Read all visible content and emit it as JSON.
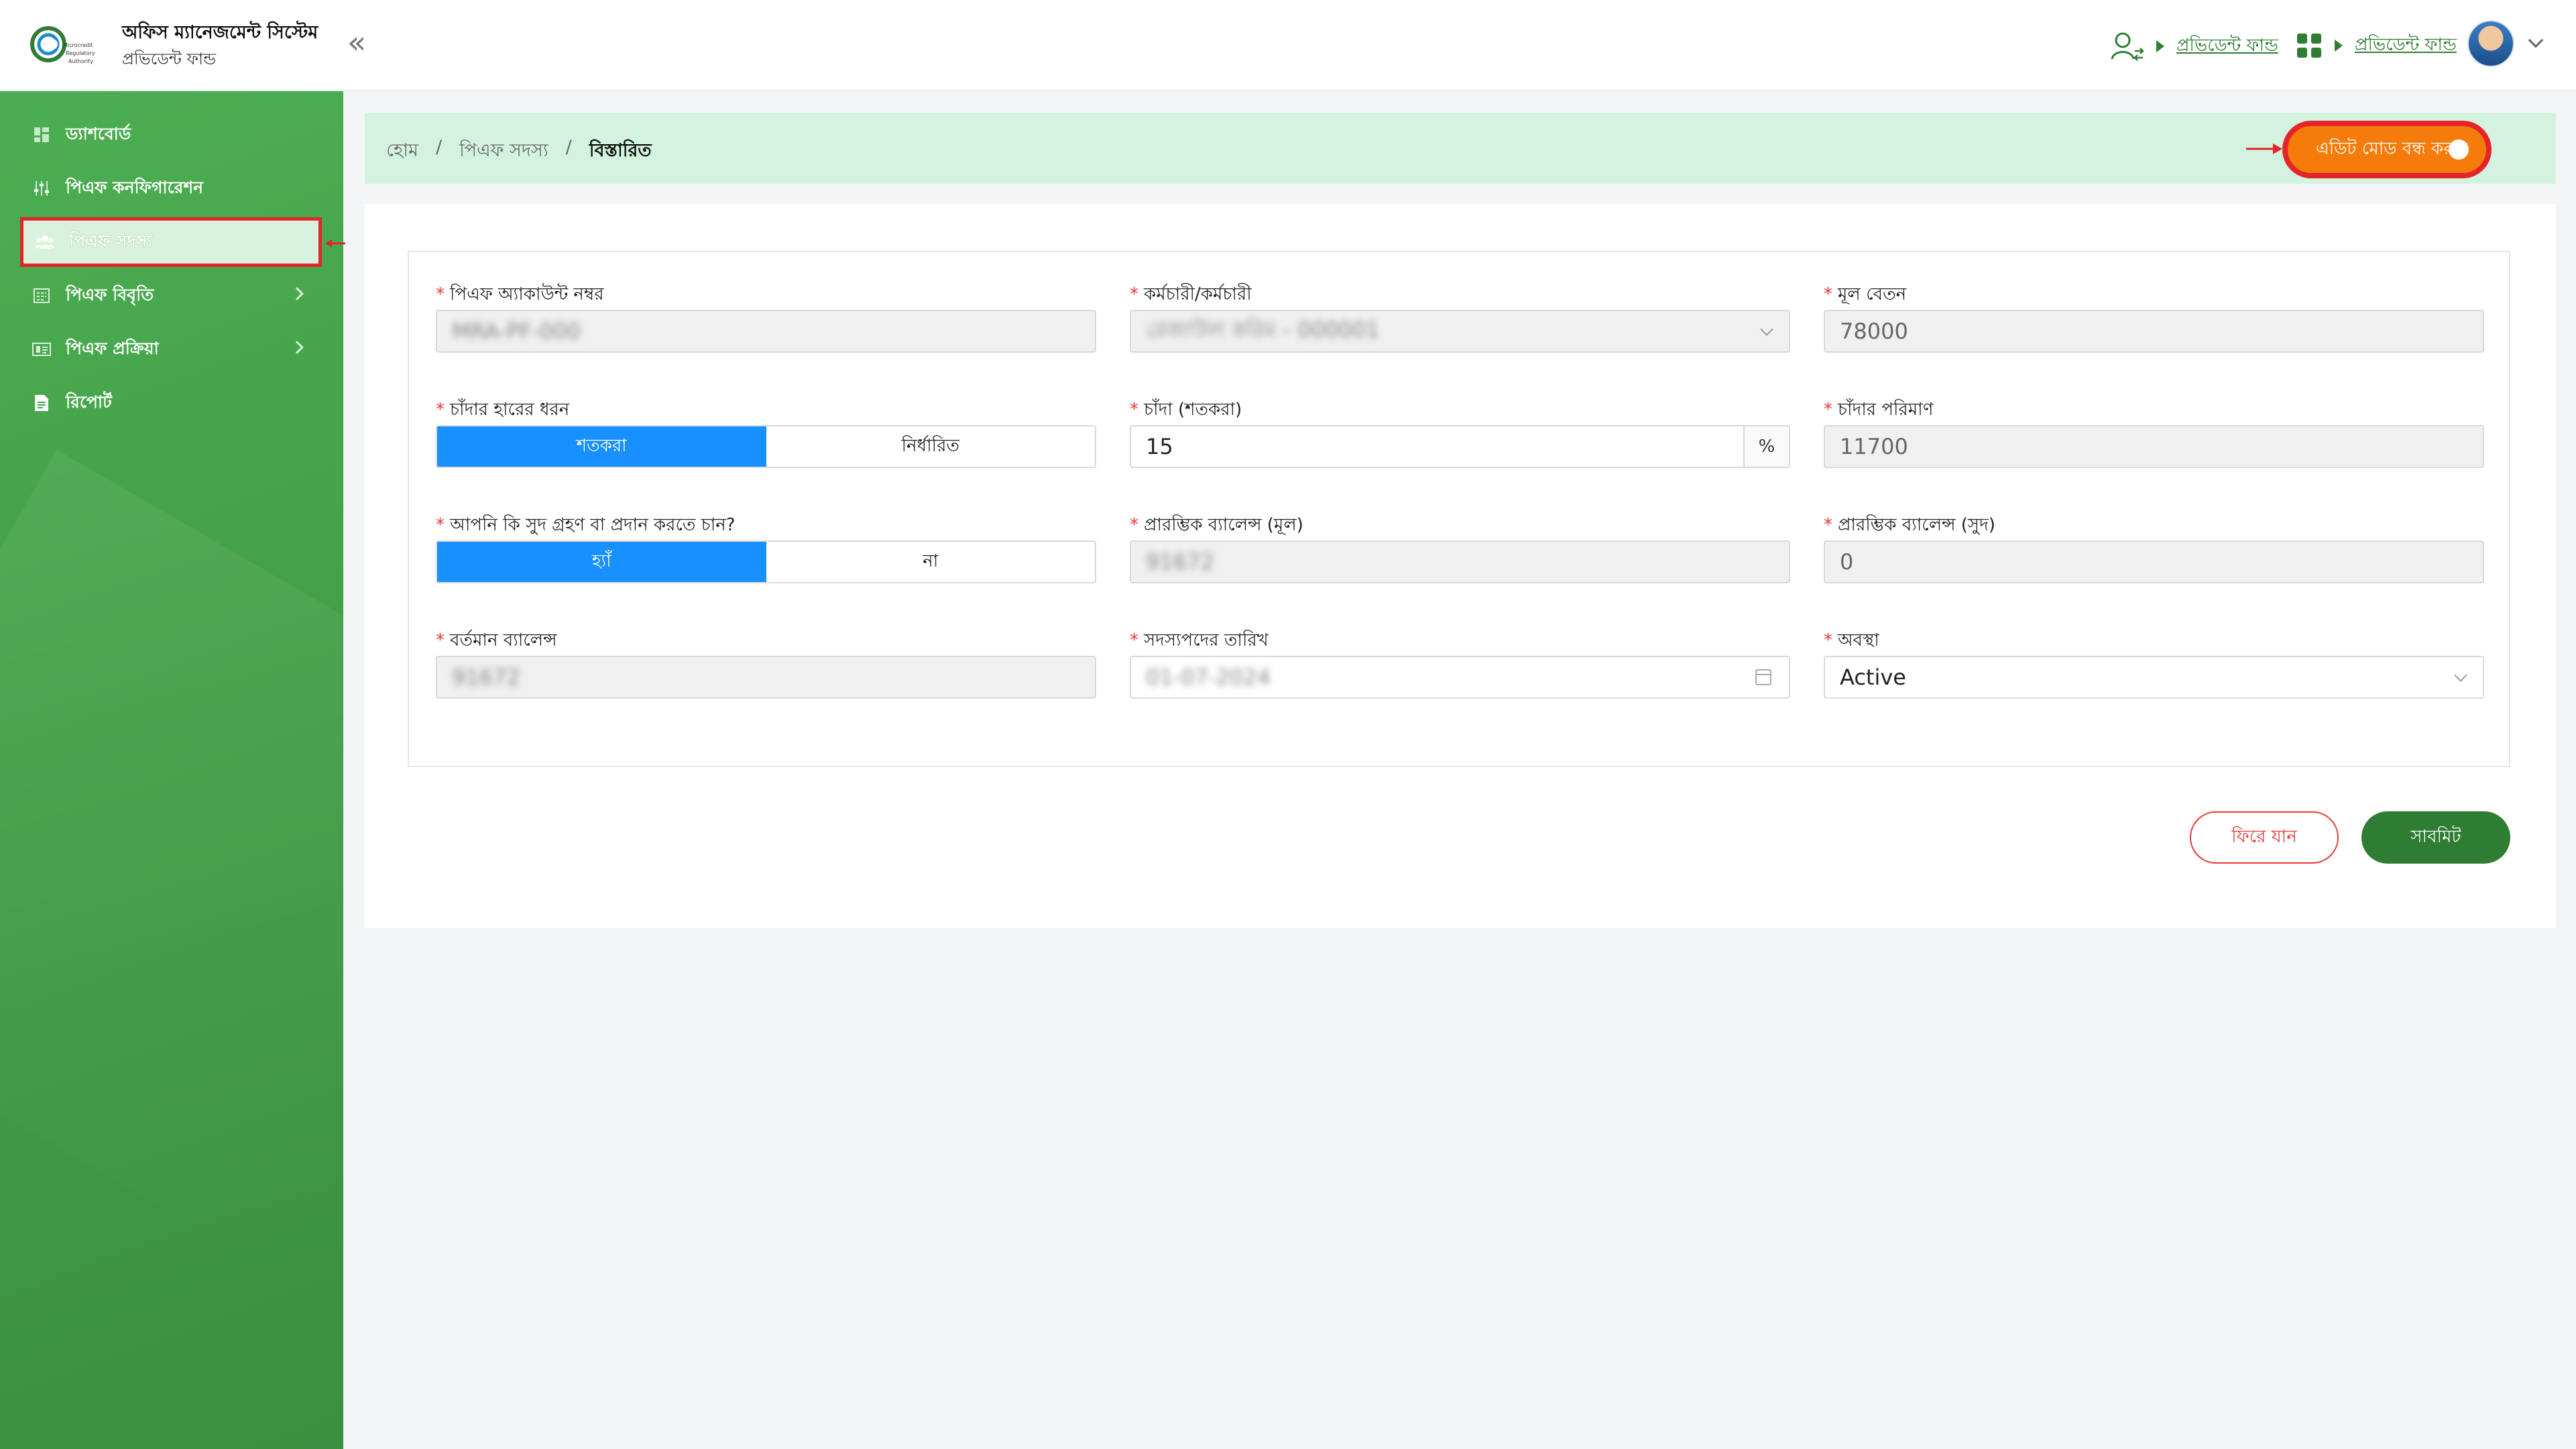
{
  "header": {
    "app_title": "অফিস ম্যানেজমেন্ট সিস্টেম",
    "app_subtitle": "প্রভিডেন্ট ফান্ড",
    "logo_text_1": "Microcredit",
    "logo_text_2": "Regulatory",
    "logo_text_3": "Authority",
    "link_1_label": "প্রভিডেন্ট ফান্ড",
    "link_2_label": "প্রভিডেন্ট ফান্ড",
    "collapse_glyph": "«"
  },
  "sidebar": {
    "items": [
      {
        "label": "ড্যাশবোর্ড",
        "icon": "dashboard-icon"
      },
      {
        "label": "পিএফ কনফিগারেশন",
        "icon": "sliders-icon"
      },
      {
        "label": "পিএফ সদস্য",
        "icon": "members-icon"
      },
      {
        "label": "পিএফ বিবৃতি",
        "icon": "statement-icon"
      },
      {
        "label": "পিএফ প্রক্রিয়া",
        "icon": "process-icon"
      },
      {
        "label": "রিপোর্ট",
        "icon": "report-icon"
      }
    ]
  },
  "breadcrumb": {
    "home": "হোম",
    "members": "পিএফ সদস্য",
    "current": "বিস্তারিত",
    "sep": "/"
  },
  "edit_toggle_label": "এডিট মোড বন্ধ করুন",
  "form": {
    "account_no": {
      "label": "পিএফ অ্যাকাউন্ট নম্বর",
      "value": "MRA-PF-000"
    },
    "employee": {
      "label": "কর্মচারী/কর্মচারী",
      "value": "রেজাউল করিম - 000001"
    },
    "basic_salary": {
      "label": "মূল বেতন",
      "value": "78000"
    },
    "rate_type": {
      "label": "চাঁদার হারের ধরন",
      "opt_percent": "শতকরা",
      "opt_fixed": "নির্ধারিত"
    },
    "contribution_pct": {
      "label": "চাঁদা (শতকরা)",
      "value": "15",
      "suffix": "%"
    },
    "contribution_amount": {
      "label": "চাঁদার পরিমাণ",
      "value": "11700"
    },
    "interest": {
      "label": "আপনি কি সুদ গ্রহণ বা প্রদান করতে চান?",
      "opt_yes": "হ্যাঁ",
      "opt_no": "না"
    },
    "opening_principal": {
      "label": "প্রারম্ভিক ব্যালেন্স (মূল)",
      "value": "91672"
    },
    "opening_interest": {
      "label": "প্রারম্ভিক ব্যালেন্স (সুদ)",
      "value": "0"
    },
    "current_balance": {
      "label": "বর্তমান ব্যালেন্স",
      "value": "91672"
    },
    "membership_date": {
      "label": "সদস্যপদের তারিখ",
      "value": "01-07-2024"
    },
    "status": {
      "label": "অবস্থা",
      "value": "Active"
    },
    "required_mark": "*"
  },
  "buttons": {
    "back": "ফিরে যান",
    "submit": "সাবমিট"
  }
}
